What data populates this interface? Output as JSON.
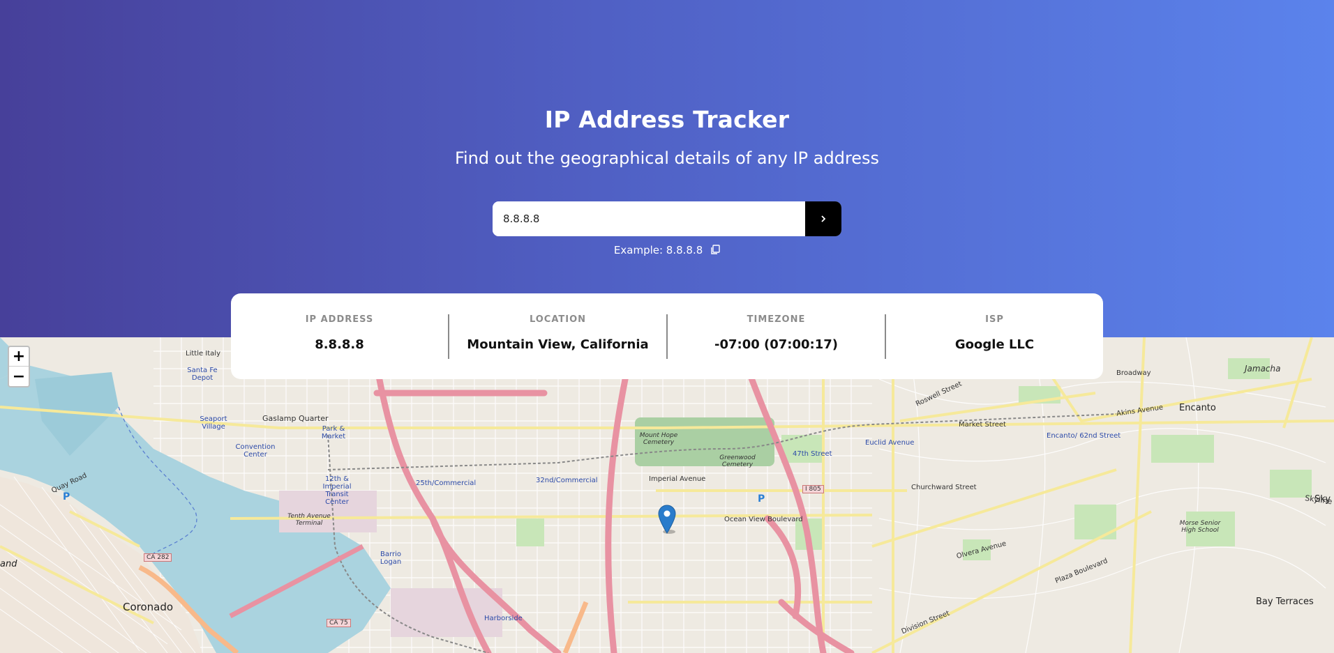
{
  "header": {
    "title": "IP Address Tracker",
    "subtitle": "Find out the geographical details of any IP address"
  },
  "search": {
    "value": "8.8.8.8",
    "example": "Example: 8.8.8.8"
  },
  "info": {
    "ip": {
      "label": "IP ADDRESS",
      "value": "8.8.8.8"
    },
    "location": {
      "label": "LOCATION",
      "value": "Mountain View, California"
    },
    "timezone": {
      "label": "TIMEZONE",
      "value": "-07:00 (07:00:17)"
    },
    "isp": {
      "label": "ISP",
      "value": "Google LLC"
    }
  },
  "map": {
    "zoom_in": "+",
    "zoom_out": "−",
    "labels": {
      "coronado": "Coronado",
      "encanto": "Encanto",
      "bay_terraces": "Bay Terraces",
      "jamacha": "Jamacha",
      "gaslamp": "Gaslamp Quarter",
      "little_italy": "Little Italy",
      "market_street": "Market Street",
      "churchward": "Churchward Street",
      "ocean_view": "Ocean View Boulevard",
      "imperial": "Imperial Avenue",
      "division": "Division Street",
      "plaza": "Plaza Boulevard",
      "euclid": "Euclid Avenue",
      "encanto_62nd": "Encanto/ 62nd Street",
      "street_47th": "47th Street",
      "commercial_25th": "25th/Commercial",
      "commercial_32nd": "32nd/Commercial",
      "barrio_logan": "Barrio Logan",
      "harborside": "Harborside",
      "convention": "Convention Center",
      "seaport": "Seaport Village",
      "santa_fe": "Santa Fe Depot",
      "park_market": "Park & Market",
      "imperial_transit": "12th & Imperial Transit Center",
      "greenwood": "Greenwood Cemetery",
      "mount_hope": "Mount Hope Cemetery",
      "i805": "I 805",
      "ca75": "CA 75",
      "ca282": "CA 282",
      "olvera": "Olvera Avenue",
      "akins": "Akins Avenue",
      "broadway": "Broadway",
      "roswell": "Roswell Street",
      "quay": "Quay Road",
      "tenth_ave": "Tenth Avenue Terminal",
      "morse": "Morse Senior High School",
      "skyline": "Skyline Drive",
      "and": "and",
      "sky": "Sky"
    }
  },
  "colors": {
    "gradient_start": "#47409a",
    "gradient_end": "#5b83ec",
    "button": "#000000",
    "marker": "#2a7ccb",
    "water": "#aad3df",
    "freeway": "#e892a2"
  }
}
